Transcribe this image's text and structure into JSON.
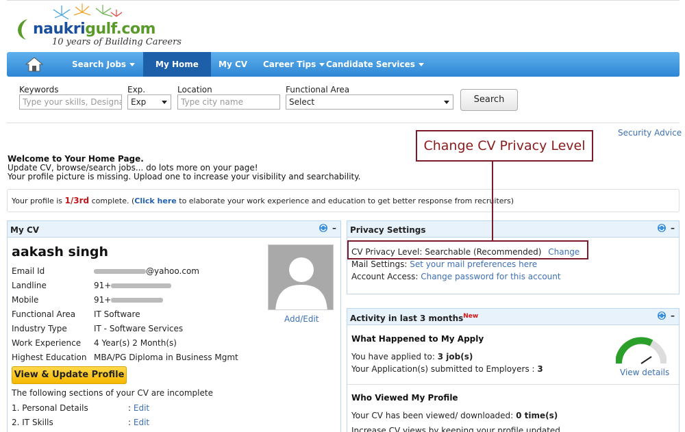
{
  "logo": {
    "brand_part1": "naukri",
    "brand_part2": "gulf.com",
    "tagline": "10 years of Building Careers"
  },
  "nav": {
    "items": [
      {
        "label": "Search Jobs",
        "dropdown": true
      },
      {
        "label": "My Home",
        "active": true
      },
      {
        "label": "My CV"
      },
      {
        "label": "Career Tips",
        "dropdown": true
      },
      {
        "label": "Candidate Services",
        "dropdown": true
      }
    ]
  },
  "search": {
    "keywords_label": "Keywords",
    "keywords_placeholder": "Type your skills, Designation",
    "exp_label": "Exp.",
    "exp_value": "Exp",
    "location_label": "Location",
    "location_placeholder": "Type city name",
    "functional_label": "Functional Area",
    "functional_value": "Select",
    "button": "Search"
  },
  "security_advice": "Security Advice",
  "callout": "Change CV Privacy Level",
  "welcome": {
    "title": "Welcome to Your Home Page.",
    "line1": "Update CV, browse/search jobs... do lots more on your page!",
    "line2": "Your profile picture is missing. Upload one to increase your visibility and searchability."
  },
  "completion": {
    "prefix": "Your profile is",
    "fraction": "1/3rd",
    "mid": "complete. (",
    "link": "Click here",
    "suffix": "to elaborate your work experience and education to get better response from recruiters)"
  },
  "mycv": {
    "title": "My CV",
    "name": "aakash singh",
    "fields": [
      {
        "label": "Email Id",
        "value": "@yahoo.com"
      },
      {
        "label": "Landline",
        "value": "91+"
      },
      {
        "label": "Mobile",
        "value": "91+"
      },
      {
        "label": "Functional Area",
        "value": "IT Software"
      },
      {
        "label": "Industry Type",
        "value": "IT - Software Services"
      },
      {
        "label": "Work Experience",
        "value": "4 Year(s) 2 Month(s)"
      },
      {
        "label": "Highest Education",
        "value": "MBA/PG Diploma in Business Mgmt"
      }
    ],
    "add_edit": "Add/Edit",
    "update_button": "View & Update Profile",
    "incomplete_text": "The following sections of your CV are incomplete",
    "sections": [
      {
        "label": "1. Personal Details",
        "colon": ":",
        "edit": "Edit"
      },
      {
        "label": "2. IT Skills",
        "colon": ":",
        "edit": "Edit"
      }
    ]
  },
  "privacy": {
    "title": "Privacy Settings",
    "cv_privacy_label": "CV Privacy Level:",
    "cv_privacy_value": "Searchable (Recommended)",
    "change_link": "Change",
    "mail_label": "Mail Settings:",
    "mail_link": "Set your mail preferences here",
    "account_label": "Account Access:",
    "account_link": "Change password for this account"
  },
  "activity": {
    "title": "Activity in last 3 months",
    "new_badge": "New",
    "apply_heading": "What Happened to My Apply",
    "applied_prefix": "You have applied to:",
    "applied_value": "3 job(s)",
    "submitted_prefix": "Your Application(s) submitted to Employers :",
    "submitted_value": "3",
    "view_details": "View details",
    "viewed_heading": "Who Viewed My Profile",
    "viewed_prefix": "Your CV has been viewed/ downloaded:",
    "viewed_value": "0 time(s)",
    "increase_text": "Increase CV views by keeping your profile updated"
  },
  "colors": {
    "nav_blue": "#2e86d4",
    "callout_red": "#7a1a2a",
    "link_blue": "#3b6fb5",
    "button_yellow": "#f5b800"
  },
  "icons": [
    "home-icon",
    "refresh-icon",
    "minimize-icon",
    "avatar-placeholder-icon",
    "gauge-icon"
  ]
}
